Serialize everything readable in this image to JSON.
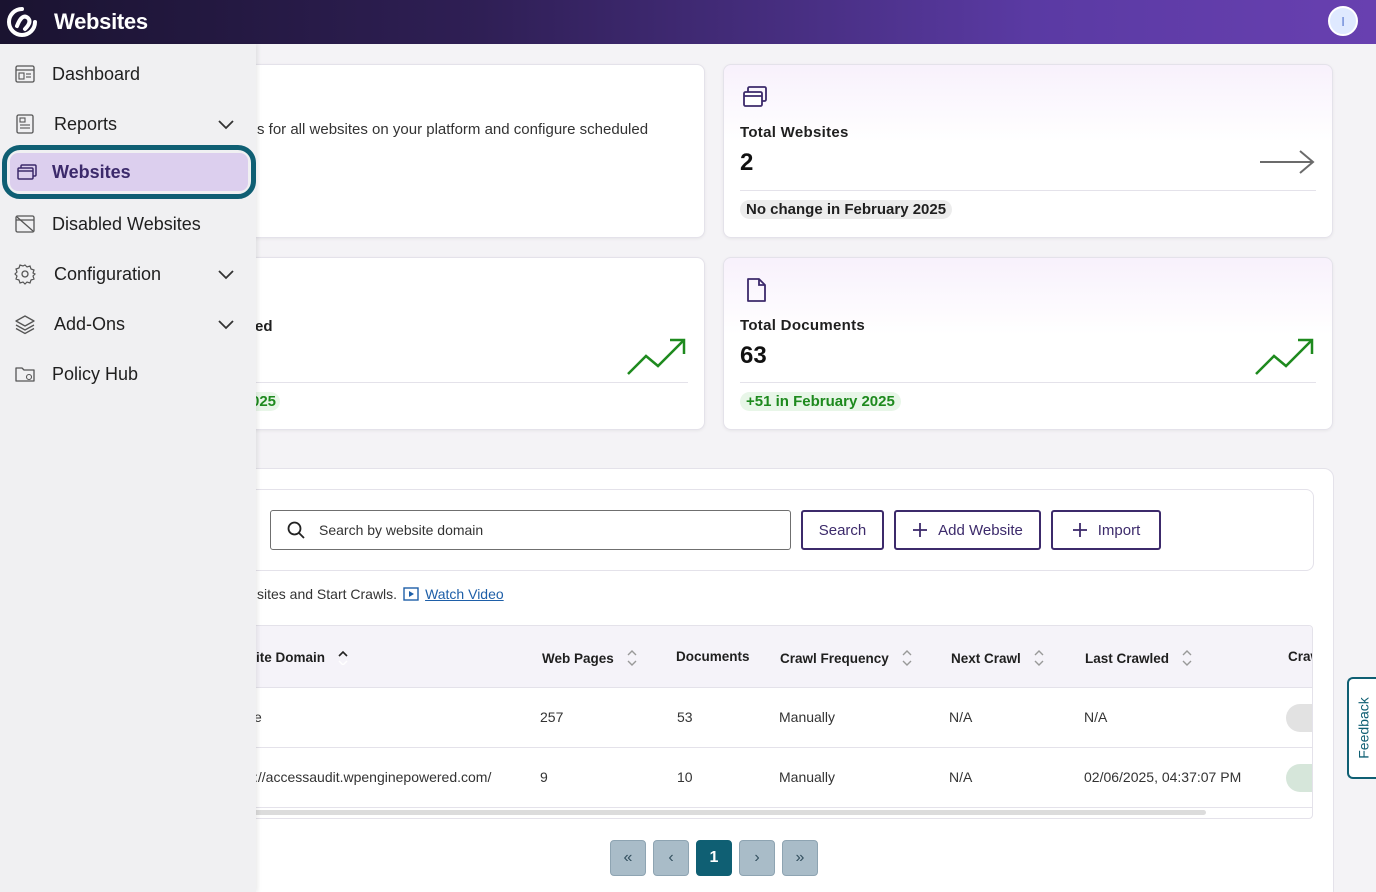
{
  "header": {
    "title": "Websites",
    "avatar_initial": "I"
  },
  "sidebar": {
    "items": [
      {
        "label": "Dashboard",
        "icon": "dashboard-icon",
        "expandable": false
      },
      {
        "label": "Reports",
        "icon": "reports-icon",
        "expandable": true
      },
      {
        "label": "Websites",
        "icon": "websites-icon",
        "expandable": false,
        "active": true
      },
      {
        "label": "Disabled Websites",
        "icon": "disabled-websites-icon",
        "expandable": false
      },
      {
        "label": "Configuration",
        "icon": "gear-icon",
        "expandable": true
      },
      {
        "label": "Add-Ons",
        "icon": "layers-icon",
        "expandable": true
      },
      {
        "label": "Policy Hub",
        "icon": "folder-icon",
        "expandable": false
      }
    ]
  },
  "intro_card": {
    "description": "s for all websites on your platform and configure scheduled"
  },
  "stats": {
    "websites": {
      "label": "Total Websites",
      "value": "2",
      "change": "No change in February 2025"
    },
    "pages_partial": {
      "label": "ed",
      "change": "025"
    },
    "documents": {
      "label": "Total Documents",
      "value": "63",
      "change": "+51 in February 2025"
    }
  },
  "search": {
    "placeholder": "Search by website domain",
    "search_label": "Search",
    "add_label": "Add Website",
    "import_label": "Import"
  },
  "help": {
    "text": "sites and Start Crawls.",
    "link": "Watch Video"
  },
  "table": {
    "columns": [
      "ite Domain",
      "Web Pages",
      "Documents",
      "Crawl Frequency",
      "Next Crawl",
      "Last Crawled",
      "Craw"
    ],
    "rows": [
      {
        "domain": "e",
        "web_pages": "257",
        "documents": "53",
        "frequency": "Manually",
        "next": "N/A",
        "last": "N/A"
      },
      {
        "domain": "://accessaudit.wpenginepowered.com/",
        "web_pages": "9",
        "documents": "10",
        "frequency": "Manually",
        "next": "N/A",
        "last": "02/06/2025, 04:37:07 PM"
      }
    ]
  },
  "pagination": {
    "first": "«",
    "prev": "‹",
    "current": "1",
    "next": "›",
    "last": "»"
  },
  "feedback_label": "Feedback",
  "colors": {
    "accent": "#0f5f73",
    "brand": "#3c2a6b",
    "positive": "#1e8a1e"
  }
}
